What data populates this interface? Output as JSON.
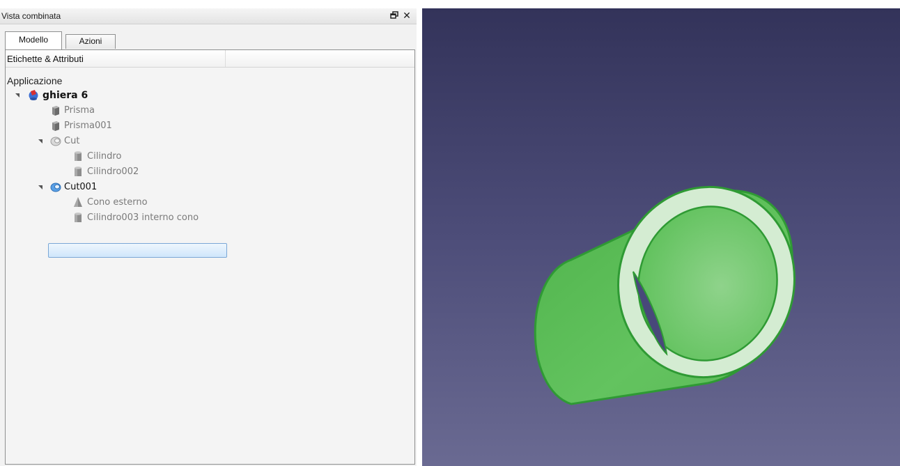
{
  "panel": {
    "title": "Vista combinata",
    "float_icon": "float-window-icon",
    "close_icon": "close-icon"
  },
  "tabs": [
    {
      "label": "Modello",
      "active": true
    },
    {
      "label": "Azioni",
      "active": false
    }
  ],
  "tree": {
    "header": "Etichette & Attributi",
    "root": "Applicazione",
    "items": [
      {
        "label": "ghiera 6",
        "icon": "document-icon",
        "expanded": true
      },
      {
        "label": "Prisma",
        "icon": "prism-icon"
      },
      {
        "label": "Prisma001",
        "icon": "prism-icon"
      },
      {
        "label": "Cut",
        "icon": "cut-icon",
        "expanded": true
      },
      {
        "label": "Cilindro",
        "icon": "cylinder-icon"
      },
      {
        "label": "Cilindro002",
        "icon": "cylinder-icon"
      },
      {
        "label": "Cut001",
        "icon": "cut-icon",
        "expanded": true,
        "selected": true
      },
      {
        "label": "Cono esterno",
        "icon": "cone-icon"
      },
      {
        "label": "Cilindro003 interno cono",
        "icon": "cylinder-icon"
      }
    ]
  },
  "viewport": {
    "object": "tube-3d-shape",
    "shape_color": "#63c35f",
    "outline_color": "#2f9a34",
    "background_top": "#33335a",
    "background_bottom": "#6a6a92"
  }
}
